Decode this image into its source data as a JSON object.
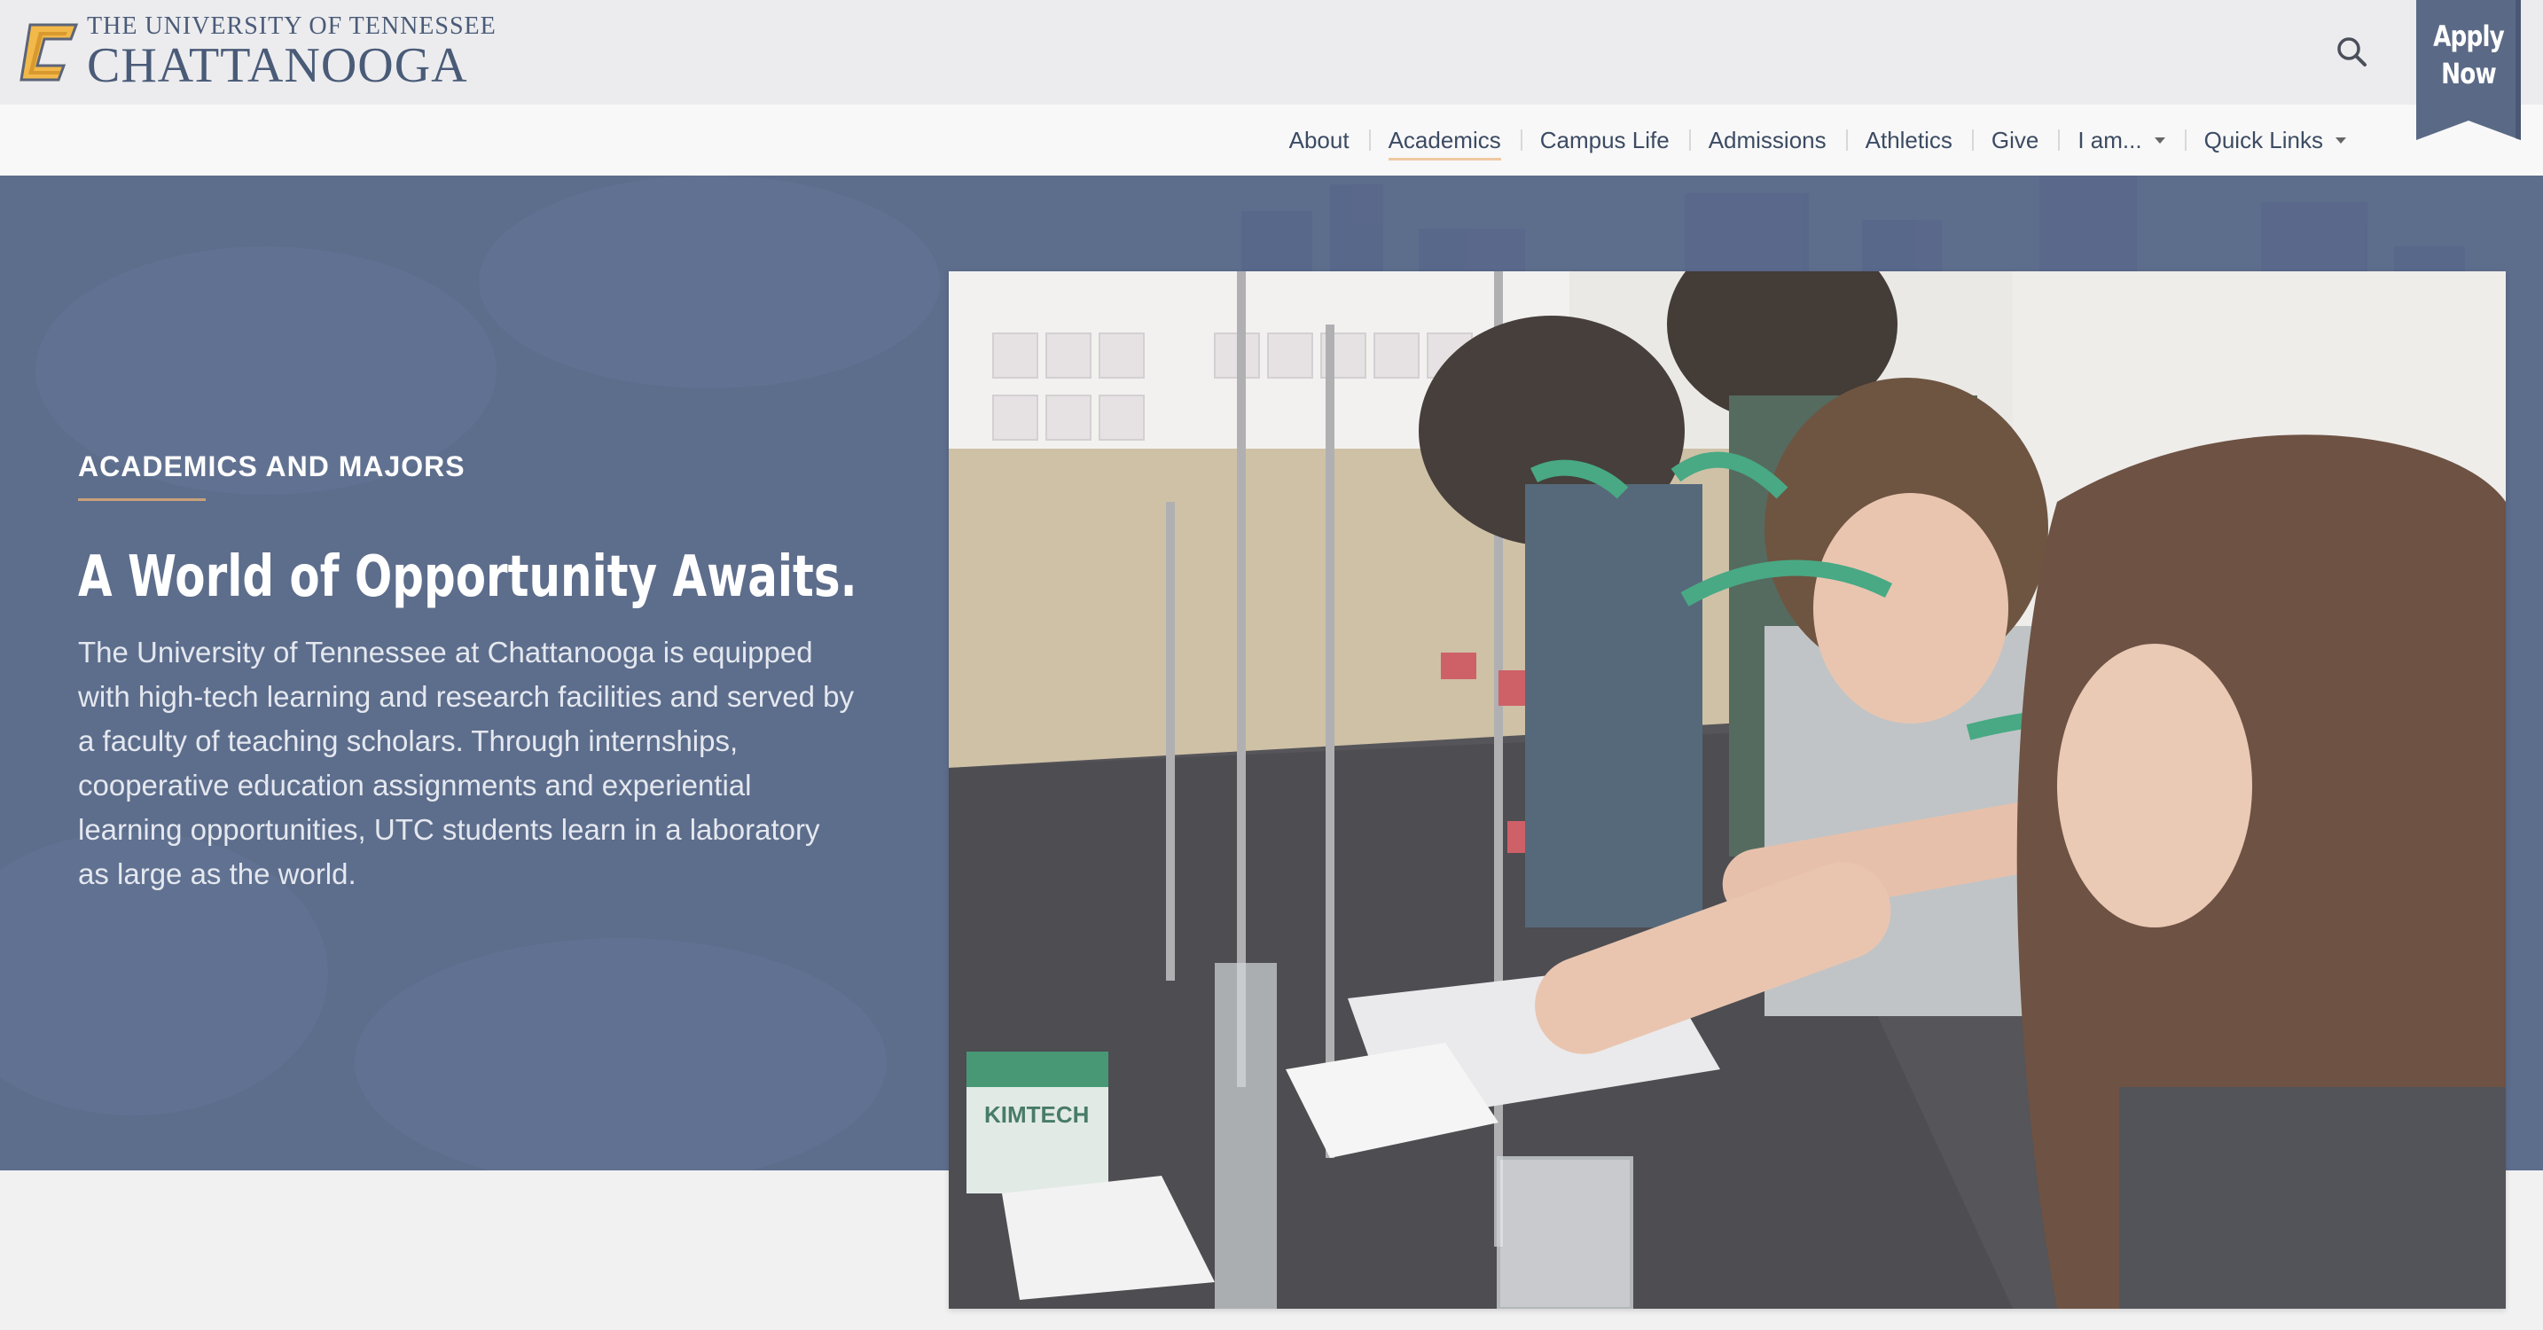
{
  "header": {
    "logo": {
      "line1": "THE UNIVERSITY OF TENNESSEE",
      "line2": "CHATTANOOGA"
    },
    "apply": {
      "line1": "Apply",
      "line2": "Now"
    }
  },
  "nav": {
    "items": [
      {
        "label": "About"
      },
      {
        "label": "Academics"
      },
      {
        "label": "Campus Life"
      },
      {
        "label": "Admissions"
      },
      {
        "label": "Athletics"
      },
      {
        "label": "Give"
      },
      {
        "label": "I am..."
      },
      {
        "label": "Quick Links"
      }
    ]
  },
  "hero": {
    "eyebrow": "ACADEMICS AND MAJORS",
    "headline": "A World of Opportunity Awaits.",
    "body": "The University of Tennessee at Chattanooga is equipped with high-tech learning and research facilities and served by a faculty of teaching scholars. Through internships, cooperative education assignments and experiential learning opportunities, UTC students learn in a laboratory as large as the world."
  },
  "photo": {
    "box_label": "KIMTECH"
  },
  "icons": {
    "search": "search-icon",
    "logo_mark": "utc-c-logo-icon",
    "dropdown": "chevron-down-icon"
  },
  "colors": {
    "navy": "#112e51",
    "hero_blue": "#5d6d8c",
    "gold": "#e8a63c",
    "tab_blue": "#5a6a86"
  }
}
